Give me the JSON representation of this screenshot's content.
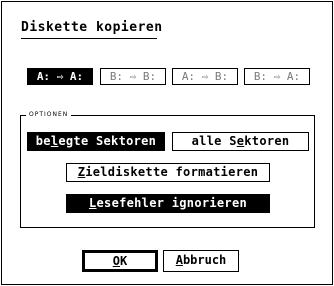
{
  "dialog": {
    "title": "Diskette kopieren"
  },
  "drives": [
    {
      "label": "A: ⇨ A:",
      "selected": true,
      "enabled": true
    },
    {
      "label": "B: ⇨ B:",
      "selected": false,
      "enabled": false
    },
    {
      "label": "A: ⇨ B:",
      "selected": false,
      "enabled": false
    },
    {
      "label": "B: ⇨ A:",
      "selected": false,
      "enabled": false
    }
  ],
  "options": {
    "group_label": "OPTIONEN",
    "belegte": {
      "pre": "be",
      "key": "l",
      "post": "egte Sektoren",
      "selected": true
    },
    "alle": {
      "pre": "alle S",
      "key": "e",
      "post": "ktoren",
      "selected": false
    },
    "format": {
      "pre": "",
      "key": "Z",
      "post": "ieldiskette formatieren",
      "selected": false
    },
    "ignore": {
      "pre": "",
      "key": "L",
      "post": "esefehler ignorieren",
      "selected": true
    }
  },
  "buttons": {
    "ok": {
      "pre": "",
      "key": "O",
      "post": "K"
    },
    "cancel": {
      "pre": "",
      "key": "A",
      "post": "bbruch"
    }
  }
}
